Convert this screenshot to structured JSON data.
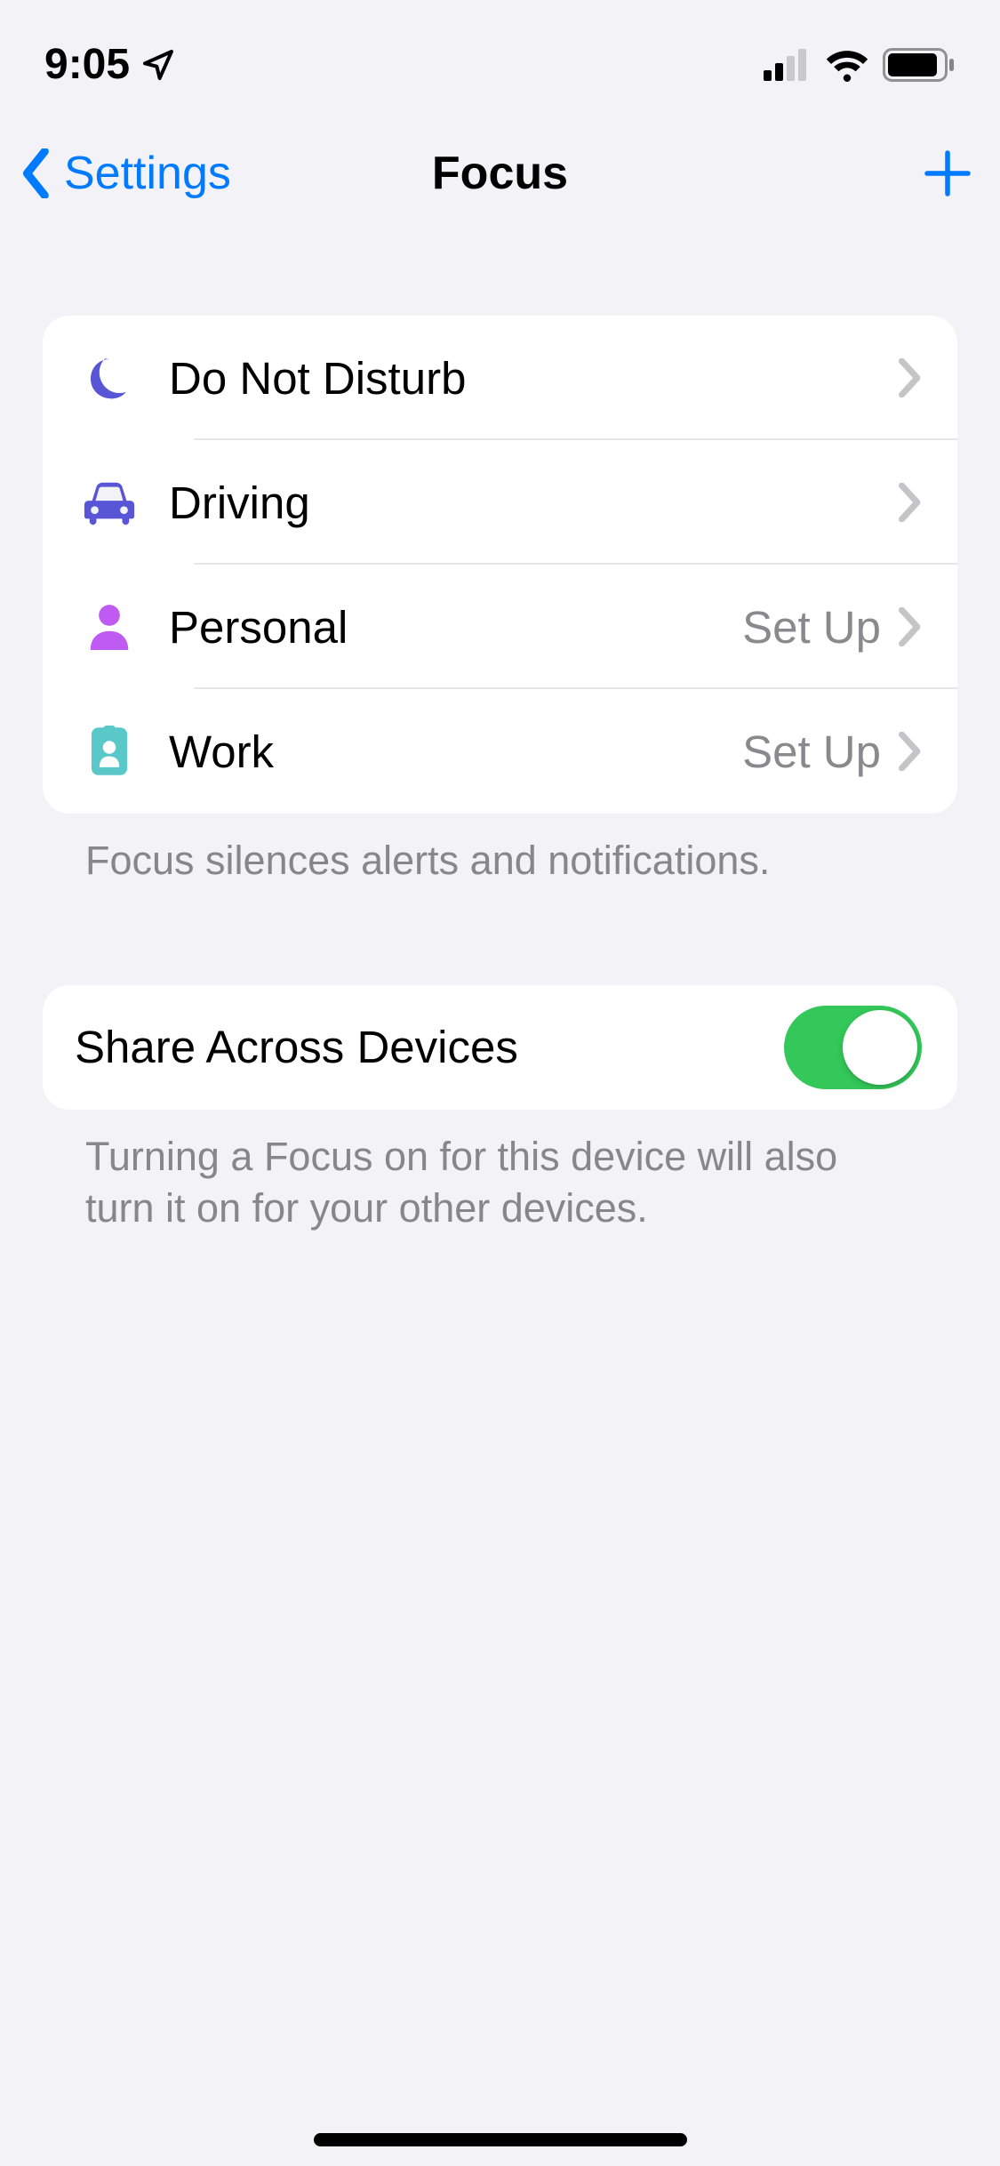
{
  "status": {
    "time": "9:05"
  },
  "nav": {
    "back_label": "Settings",
    "title": "Focus"
  },
  "focus_list": {
    "items": [
      {
        "label": "Do Not Disturb",
        "detail": ""
      },
      {
        "label": "Driving",
        "detail": ""
      },
      {
        "label": "Personal",
        "detail": "Set Up"
      },
      {
        "label": "Work",
        "detail": "Set Up"
      }
    ],
    "footer": "Focus silences alerts and notifications."
  },
  "share": {
    "label": "Share Across Devices",
    "footer": "Turning a Focus on for this device will also turn it on for your other devices."
  }
}
